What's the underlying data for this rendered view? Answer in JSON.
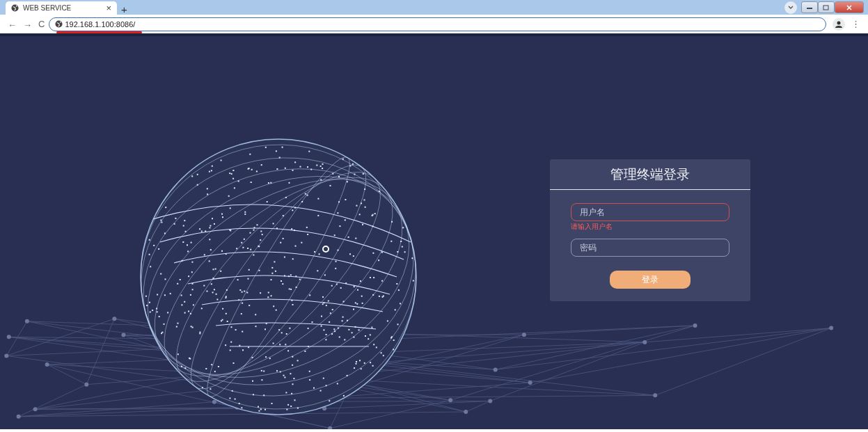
{
  "browser": {
    "tab": {
      "title": "WEB SERVICE",
      "close": "×",
      "new_tab": "+"
    },
    "address": "192.168.1.100:8086/",
    "nav": {
      "back": "←",
      "forward": "→",
      "reload": "C"
    },
    "menu": "⋮"
  },
  "login": {
    "title": "管理终端登录",
    "fields": [
      {
        "placeholder": "用户名",
        "invalid": true,
        "error": "请输入用户名"
      },
      {
        "placeholder": "密码",
        "invalid": false
      }
    ],
    "submit": "登录"
  }
}
